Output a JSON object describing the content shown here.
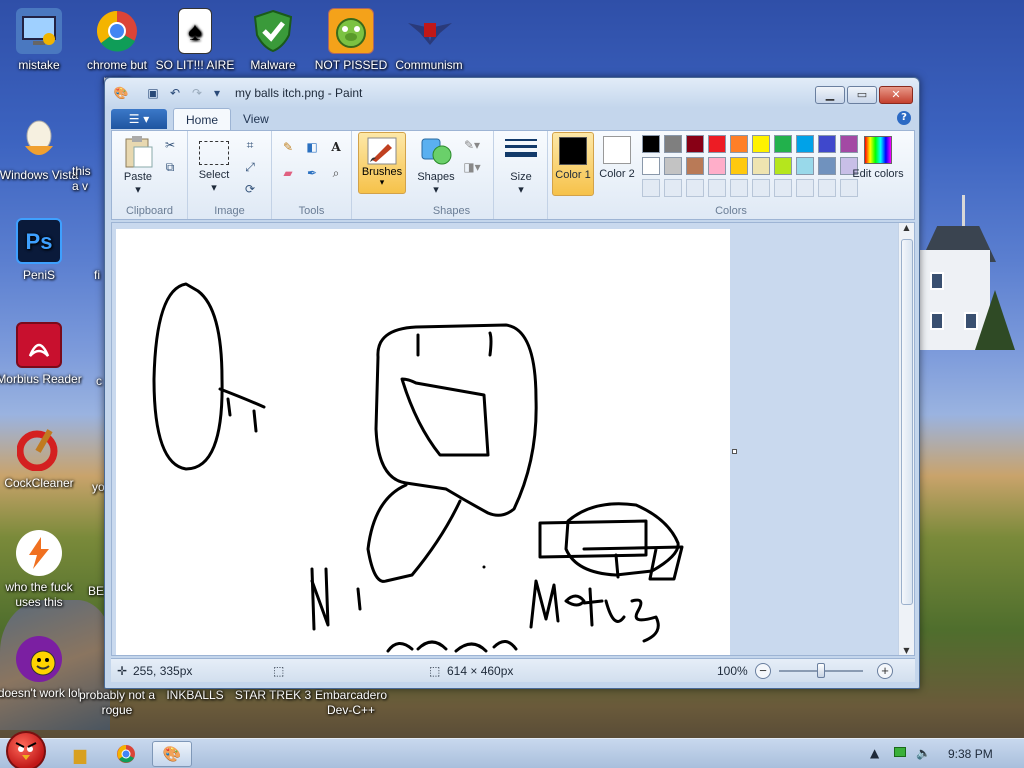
{
  "desktop": {
    "top_icons": [
      {
        "label": "mistake",
        "icon": "monitor-icon"
      },
      {
        "label": "chrome but norm",
        "icon": "chrome-icon"
      },
      {
        "label": "SO LIT!!! AIRE",
        "icon": "solitaire-icon"
      },
      {
        "label": "Malware",
        "icon": "shield-icon"
      },
      {
        "label": "NOT PISSED",
        "icon": "bad-piggies-icon"
      },
      {
        "label": "Communism",
        "icon": "emblem-icon"
      }
    ],
    "left_icons": [
      {
        "label": "Windows Vista",
        "icon": "egg-icon"
      },
      {
        "label": "PeniS",
        "icon": "photoshop-icon",
        "text": "Ps"
      },
      {
        "label": "Morbius Reader",
        "icon": "pdf-icon"
      },
      {
        "label": "CockCleaner",
        "icon": "ccleaner-icon"
      },
      {
        "label": "who the fuck uses this",
        "icon": "lightning-icon"
      },
      {
        "label": "doesn't work lol",
        "icon": "yahoo-icon"
      }
    ],
    "partial_labels": [
      "this",
      "a v",
      "fi",
      "c",
      "yo",
      "BE"
    ],
    "bottom_icons": [
      {
        "label": "probably not a rogue"
      },
      {
        "label": "INKBALLS"
      },
      {
        "label": "STAR TREK 3"
      },
      {
        "label": "Embarcadero Dev-C++"
      }
    ]
  },
  "window": {
    "title": "my balls itch.png - Paint",
    "file_tab_icon": "menu-icon",
    "tabs": [
      "Home",
      "View"
    ],
    "groups": {
      "clipboard": {
        "label": "Clipboard",
        "paste": "Paste"
      },
      "image": {
        "label": "Image",
        "select": "Select"
      },
      "tools": {
        "label": "Tools"
      },
      "brushes": {
        "label": "Brushes"
      },
      "shapes": {
        "label": "Shapes",
        "button": "Shapes"
      },
      "size": {
        "label": "Size"
      },
      "colors": {
        "label": "Colors",
        "color1": "Color 1",
        "color2": "Color 2",
        "edit": "Edit colors",
        "color1_value": "#000000",
        "color2_value": "#ffffff",
        "palette_row1": [
          "#000000",
          "#7f7f7f",
          "#880015",
          "#ed1c24",
          "#ff7f27",
          "#fff200",
          "#22b14c",
          "#00a2e8",
          "#3f48cc",
          "#a349a4"
        ],
        "palette_row2": [
          "#ffffff",
          "#c3c3c3",
          "#b97a57",
          "#ffaec9",
          "#ffc90e",
          "#efe4b0",
          "#b5e61d",
          "#99d9ea",
          "#7092be",
          "#c8bfe7"
        ]
      }
    },
    "status": {
      "cursor": "255, 335px",
      "size": "614 × 460px",
      "zoom": "100%",
      "zoom_out": "−",
      "zoom_in": "+"
    },
    "canvas_text": [
      "N",
      "Matus"
    ]
  },
  "taskbar": {
    "clock": "9:38 PM",
    "tray_icons": [
      "show-hidden-icon",
      "network-icon",
      "volume-icon"
    ]
  }
}
